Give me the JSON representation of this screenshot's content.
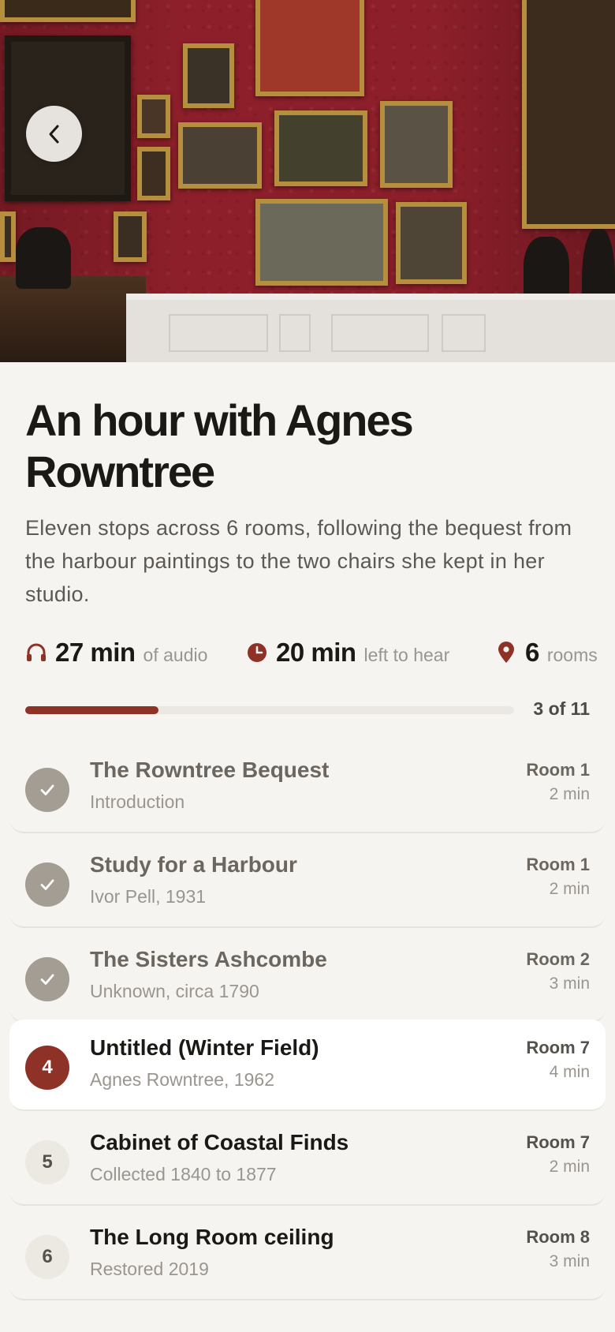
{
  "hero": {
    "back_icon": "chevron-left-icon"
  },
  "tour": {
    "title": "An hour with Agnes Rowntree",
    "description": "Eleven stops across 6 rooms, following the bequest from the harbour paintings to the two chairs she kept in her studio."
  },
  "stats": {
    "audio": {
      "icon": "headphones-icon",
      "value": "27 min",
      "label": "of audio"
    },
    "left": {
      "icon": "clock-icon",
      "value": "20 min",
      "label": "left to hear"
    },
    "rooms": {
      "icon": "location-pin-icon",
      "value": "6",
      "label": "rooms"
    }
  },
  "progress": {
    "count_label": "3 of 11",
    "current": 3,
    "total": 11,
    "fraction": 0.273
  },
  "colors": {
    "accent": "#8e3127",
    "done": "#a39d94",
    "background": "#f6f4f0"
  },
  "stops": [
    {
      "state": "done",
      "badge": "",
      "title": "The Rowntree Bequest",
      "subtitle": "Introduction",
      "room": "Room 1",
      "duration": "2 min"
    },
    {
      "state": "done",
      "badge": "",
      "title": "Study for a Harbour",
      "subtitle": "Ivor Pell, 1931",
      "room": "Room 1",
      "duration": "2 min"
    },
    {
      "state": "done",
      "badge": "",
      "title": "The Sisters Ashcombe",
      "subtitle": "Unknown, circa 1790",
      "room": "Room 2",
      "duration": "3 min"
    },
    {
      "state": "current",
      "badge": "4",
      "title": "Untitled (Winter Field)",
      "subtitle": "Agnes Rowntree, 1962",
      "room": "Room 7",
      "duration": "4 min"
    },
    {
      "state": "upcoming",
      "badge": "5",
      "title": "Cabinet of Coastal Finds",
      "subtitle": "Collected 1840 to 1877",
      "room": "Room 7",
      "duration": "2 min"
    },
    {
      "state": "upcoming",
      "badge": "6",
      "title": "The Long Room ceiling",
      "subtitle": "Restored 2019",
      "room": "Room 8",
      "duration": "3 min"
    }
  ]
}
